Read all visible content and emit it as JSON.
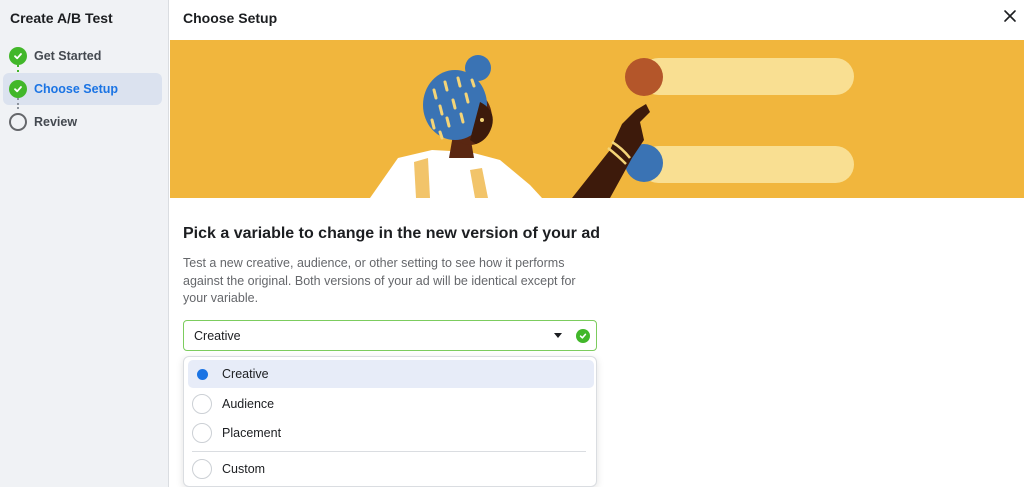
{
  "sidebar": {
    "title": "Create A/B Test",
    "steps": [
      {
        "label": "Get Started",
        "state": "done"
      },
      {
        "label": "Choose Setup",
        "state": "active"
      },
      {
        "label": "Review",
        "state": "pending"
      }
    ]
  },
  "header": {
    "title": "Choose Setup",
    "close_icon": "close-icon"
  },
  "banner": {
    "illustration": "person-pointing-at-options-illustration",
    "background_color": "#f1b63d"
  },
  "content": {
    "heading": "Pick a variable to change in the new version of your ad",
    "description": "Test a new creative, audience, or other setting to see how it performs against the original. Both versions of your ad will be identical except for your variable."
  },
  "select": {
    "value": "Creative",
    "status_icon": "check-circle-icon",
    "options": [
      {
        "label": "Creative",
        "selected": true
      },
      {
        "label": "Audience",
        "selected": false
      },
      {
        "label": "Placement",
        "selected": false
      },
      {
        "label": "Custom",
        "selected": false
      }
    ]
  },
  "colors": {
    "accent_blue": "#1b74e4",
    "success_green": "#42b72a",
    "sidebar_bg": "#f0f2f5"
  }
}
